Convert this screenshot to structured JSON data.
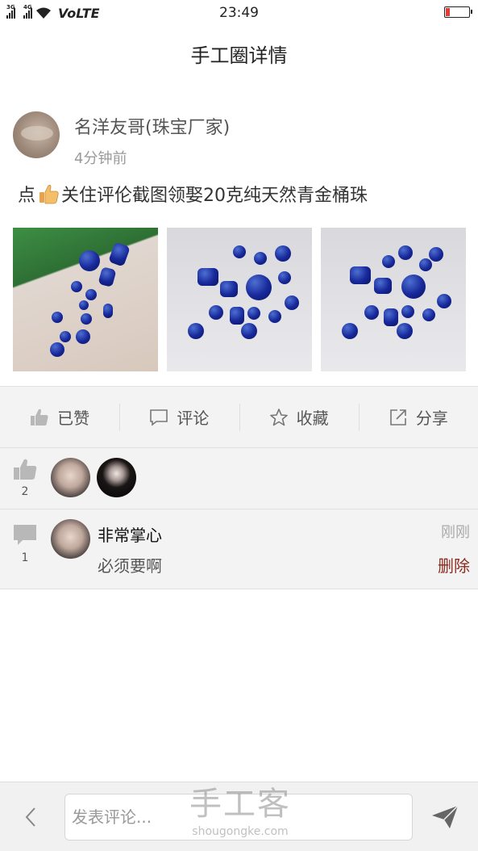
{
  "status_bar": {
    "signal_1": "3G",
    "signal_2": "4G",
    "network": "VoLTE",
    "time": "23:49"
  },
  "header": {
    "title": "手工圈详情"
  },
  "post": {
    "author": "名洋友哥(珠宝厂家)",
    "time": "4分钟前",
    "text_before": "点",
    "text_after": "关住评伦截图领娶20克纯天然青金桶珠",
    "emoji_icon": "thumbs-up-emoji"
  },
  "actions": [
    {
      "label": "已赞",
      "icon": "like-icon"
    },
    {
      "label": "评论",
      "icon": "comment-icon"
    },
    {
      "label": "收藏",
      "icon": "star-icon"
    },
    {
      "label": "分享",
      "icon": "share-icon"
    }
  ],
  "likes": {
    "count": "2"
  },
  "comments": {
    "count": "1",
    "items": [
      {
        "name": "非常掌心",
        "text": "必须要啊",
        "time": "刚刚",
        "delete_label": "删除"
      }
    ]
  },
  "bottom_bar": {
    "placeholder": "发表评论...",
    "watermark_main": "手工客",
    "watermark_sub": "shougongke.com"
  },
  "colors": {
    "background": "#ffffff",
    "panel": "#f3f3f3",
    "delete": "#8b2a1e",
    "battery_low": "#e53935"
  }
}
